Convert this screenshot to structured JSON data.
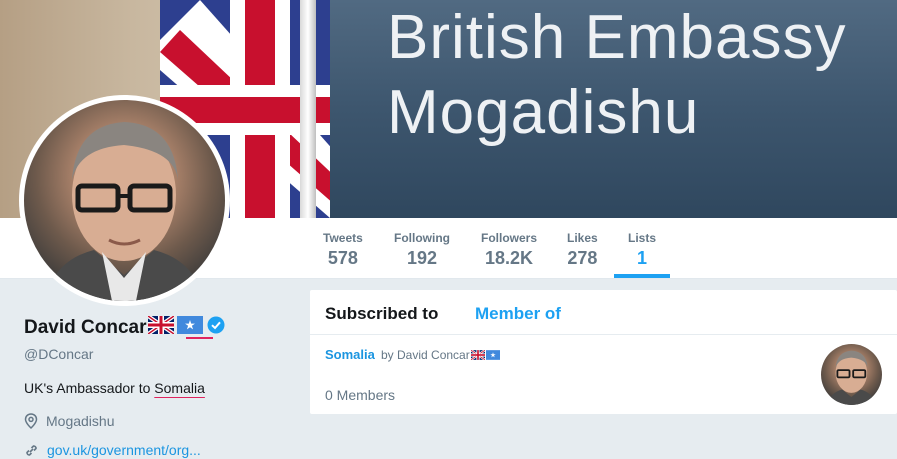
{
  "banner": {
    "sign_line1": "British Embassy",
    "sign_line2": "Mogadishu"
  },
  "nav": {
    "stats": [
      {
        "label": "Tweets",
        "value": "578"
      },
      {
        "label": "Following",
        "value": "192"
      },
      {
        "label": "Followers",
        "value": "18.2K"
      },
      {
        "label": "Likes",
        "value": "278"
      },
      {
        "label": "Lists",
        "value": "1"
      }
    ],
    "active_stat": "Lists"
  },
  "profile": {
    "name": "David Concar",
    "handle": "@DConcar",
    "bio_prefix": "UK's Ambassador to ",
    "bio_country": "Somalia",
    "location": "Mogadishu",
    "website": "gov.uk/government/org...",
    "icons": [
      "uk-flag-icon",
      "somalia-flag-icon",
      "verified-badge-icon",
      "location-pin-icon",
      "link-icon"
    ]
  },
  "lists_panel": {
    "tabs": [
      {
        "label": "Subscribed to",
        "active": false
      },
      {
        "label": "Member of",
        "active": true
      }
    ],
    "items": [
      {
        "name": "Somalia",
        "by": "by David Concar",
        "members": "0 Members"
      }
    ]
  },
  "colors": {
    "accent": "#1da1f2",
    "link": "#1b95e0",
    "muted": "#657786",
    "background": "#e6ecf0",
    "annotation_red": "#e0245e"
  }
}
